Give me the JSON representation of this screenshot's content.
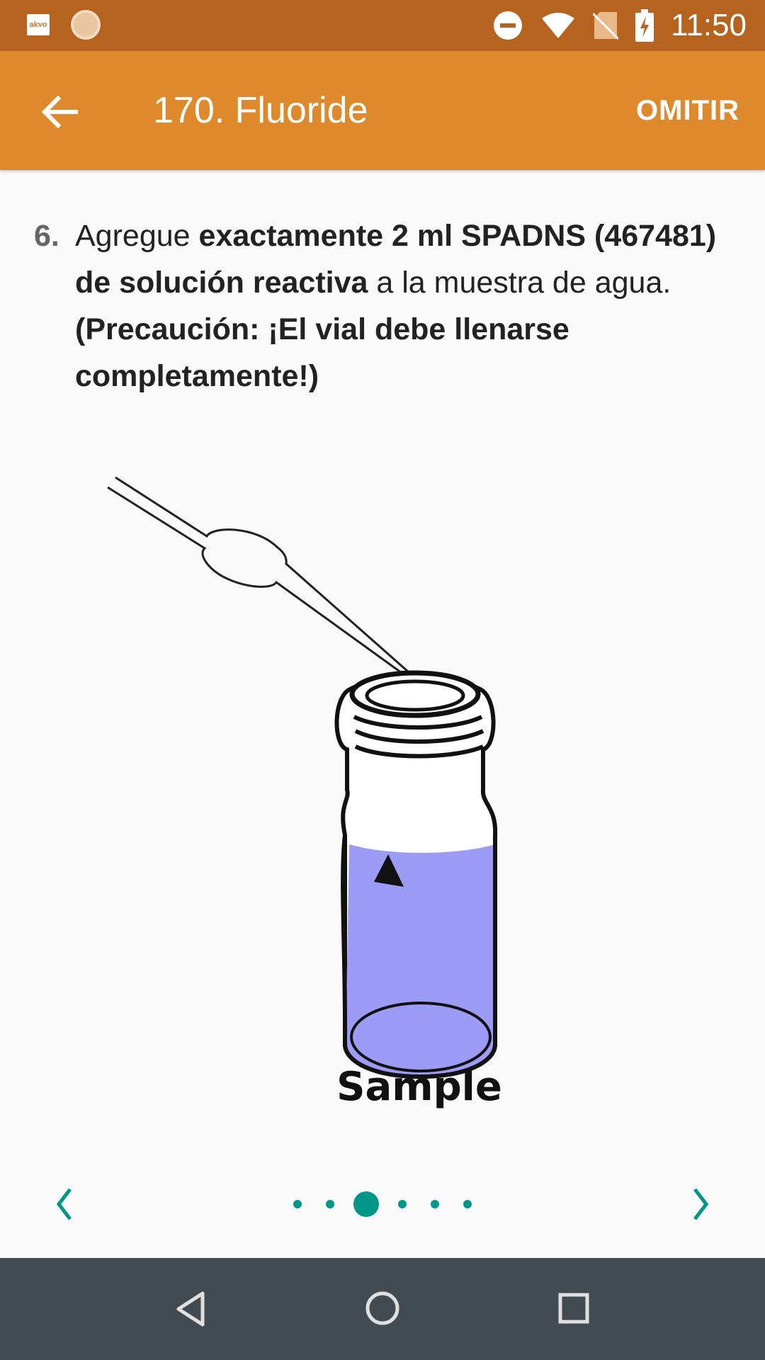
{
  "status_bar": {
    "app_icon_label": "akvo",
    "time": "11:50",
    "icons": [
      "akvo-icon",
      "sun-icon",
      "dnd-icon",
      "wifi-icon",
      "no-sim-icon",
      "battery-charging-icon"
    ]
  },
  "app_bar": {
    "title": "170. Fluoride",
    "skip_label": "OMITIR",
    "color": "#de8a2c"
  },
  "instruction": {
    "number": "6.",
    "parts": {
      "p1": "Agregue ",
      "p2": "exactamente 2 ml SPADNS (467481) de solución reactiva",
      "p3": " a la muestra de agua. ",
      "p4": "(Precaución: ¡El vial debe llenarse completamente!)"
    }
  },
  "illustration": {
    "vial_label": "Sample",
    "liquid_color": "#9c9cf6"
  },
  "pager": {
    "page_count": 6,
    "current_index": 2,
    "accent_color": "#009688"
  },
  "nav_bar": {
    "icons": [
      "back-triangle-icon",
      "home-circle-icon",
      "recents-square-icon"
    ]
  }
}
